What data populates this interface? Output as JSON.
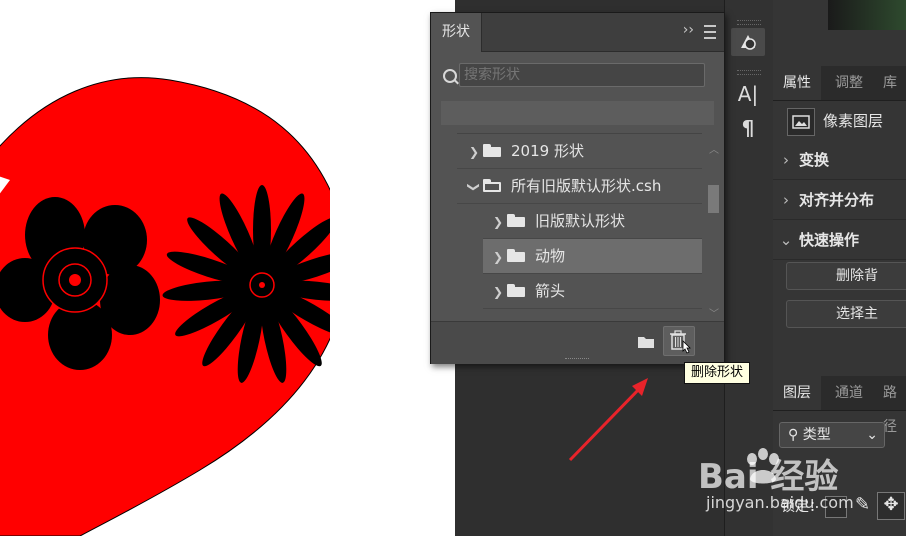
{
  "shapes_panel": {
    "tab_label": "形状",
    "collapse_glyph": "››",
    "search_placeholder": "搜索形状",
    "tree": [
      {
        "label": "2019 形状",
        "expanded": false,
        "level": 0
      },
      {
        "label": "所有旧版默认形状.csh",
        "expanded": true,
        "level": 0
      },
      {
        "label": "旧版默认形状",
        "expanded": false,
        "level": 1
      },
      {
        "label": "动物",
        "expanded": false,
        "level": 1,
        "selected": true
      },
      {
        "label": "箭头",
        "expanded": false,
        "level": 1
      }
    ],
    "tooltip": "删除形状"
  },
  "tool_strip": {
    "type_tool_label": "A|",
    "paragraph_label": "¶"
  },
  "properties_panel": {
    "tabs": [
      "属性",
      "调整",
      "库"
    ],
    "layer_type": "像素图层",
    "sections": [
      "变换",
      "对齐并分布",
      "快速操作"
    ],
    "buttons": [
      "删除背",
      "选择主"
    ]
  },
  "layers_panel": {
    "tabs": [
      "图层",
      "通道",
      "路径"
    ],
    "filter_label": "类型",
    "lock_label": "锁定："
  },
  "watermark": {
    "main": "Bai  经验",
    "sub": "jingyan.baidu.com"
  },
  "colors": {
    "heart": "#ff0000",
    "panel_bg": "#535353",
    "tooltip_bg": "#ffffe1",
    "arrow": "#e8232a"
  }
}
